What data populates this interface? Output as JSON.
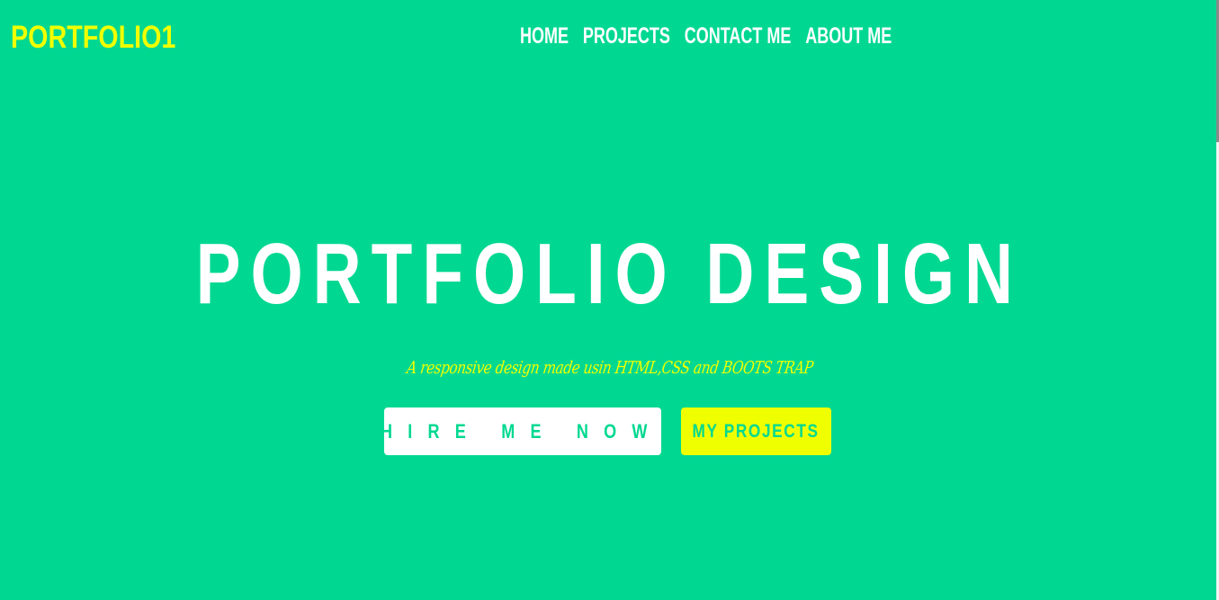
{
  "header": {
    "logo": "PORTFOLIO1",
    "nav": [
      {
        "label": "HOME"
      },
      {
        "label": "PROJECTS"
      },
      {
        "label": "CONTACT ME"
      },
      {
        "label": "ABOUT ME"
      }
    ]
  },
  "hero": {
    "title": "PORTFOLIO DESIGN",
    "tagline": "A responsive design made usin HTML,CSS and BOOTS TRAP",
    "buttons": {
      "hire": "HIRE ME NOW!",
      "projects": "MY PROJECTS"
    }
  },
  "colors": {
    "background": "#00d891",
    "accent": "#f0ff00",
    "text": "#ffffff"
  }
}
